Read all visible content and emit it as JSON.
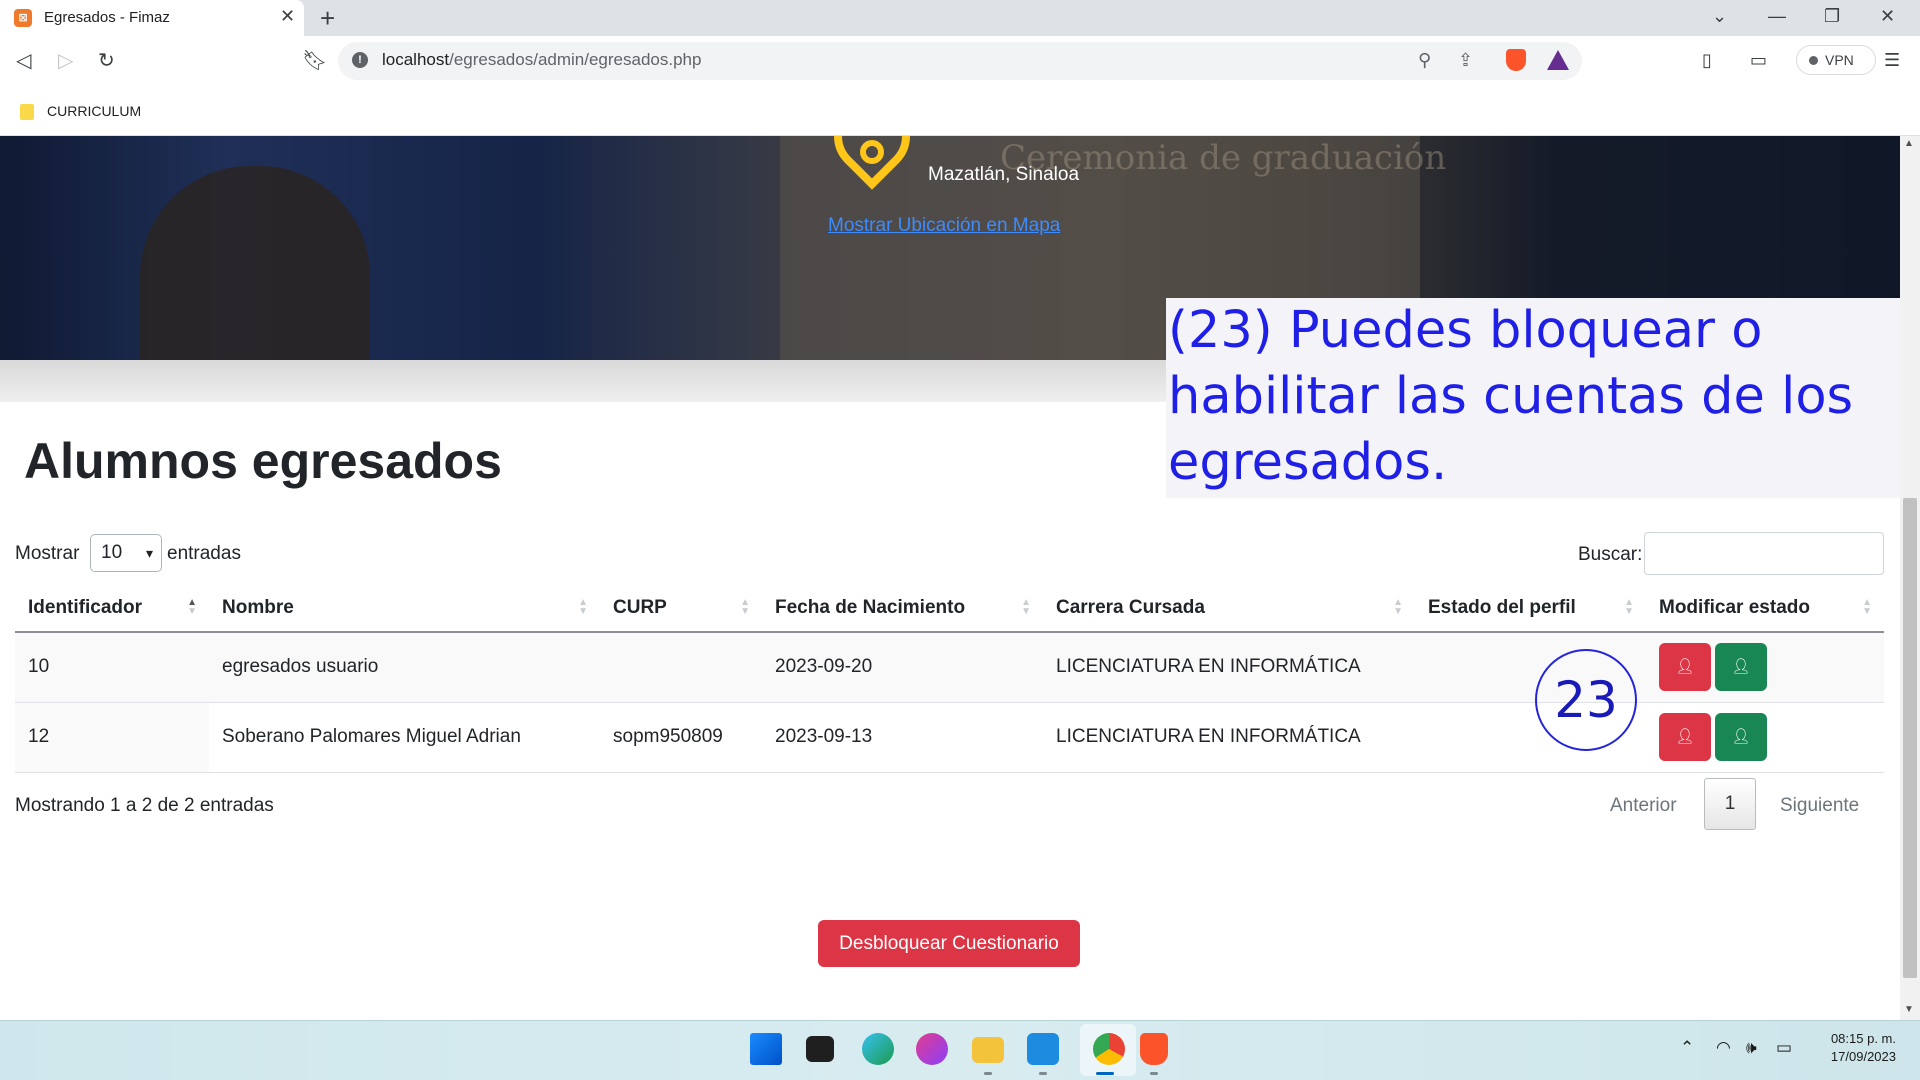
{
  "browser": {
    "tab_title": "Egresados - Fimaz",
    "url_host": "localhost",
    "url_path": "/egresados/admin/egresados.php",
    "vpn_label": "VPN",
    "bookmarks": [
      {
        "label": "CURRICULUM"
      }
    ]
  },
  "hero": {
    "location": "Mazatlán, Sinaloa",
    "map_link": "Mostrar Ubicación en Mapa",
    "background_text": "Ceremonia de graduación",
    "pin_color": "#ffc61a"
  },
  "page": {
    "title": "Alumnos egresados",
    "length_label_before": "Mostrar",
    "length_value": "10",
    "length_label_after": "entradas",
    "search_label": "Buscar:",
    "search_value": ""
  },
  "table": {
    "columns": [
      "Identificador",
      "Nombre",
      "CURP",
      "Fecha de Nacimiento",
      "Carrera Cursada",
      "Estado del perfil",
      "Modificar estado"
    ],
    "rows": [
      {
        "id": "10",
        "nombre": "egresados usuario",
        "curp": "",
        "fecha": "2023-09-20",
        "carrera": "LICENCIATURA EN INFORMÁTICA",
        "estado": ""
      },
      {
        "id": "12",
        "nombre": "Soberano Palomares Miguel Adrian",
        "curp": "sopm950809",
        "fecha": "2023-09-13",
        "carrera": "LICENCIATURA EN INFORMÁTICA",
        "estado": ""
      }
    ],
    "action_icons": {
      "block": "user-block-icon",
      "enable": "user-check-icon"
    },
    "colors": {
      "block": "#dc3545",
      "enable": "#198754"
    }
  },
  "pagination": {
    "info": "Mostrando 1 a 2 de 2 entradas",
    "prev": "Anterior",
    "current": "1",
    "next": "Siguiente"
  },
  "unlock_button": "Desbloquear Cuestionario",
  "annotation": {
    "text": "(23) Puedes bloquear o habilitar las cuentas de los egresados.",
    "badge": "23",
    "color": "#1f1fe6"
  },
  "taskbar": {
    "apps": [
      "start-icon",
      "task-view-icon",
      "edge-icon",
      "wps-icon",
      "file-explorer-icon",
      "vscode-icon",
      "chrome-icon",
      "brave-icon"
    ],
    "time": "08:15 p. m.",
    "date": "17/09/2023"
  }
}
